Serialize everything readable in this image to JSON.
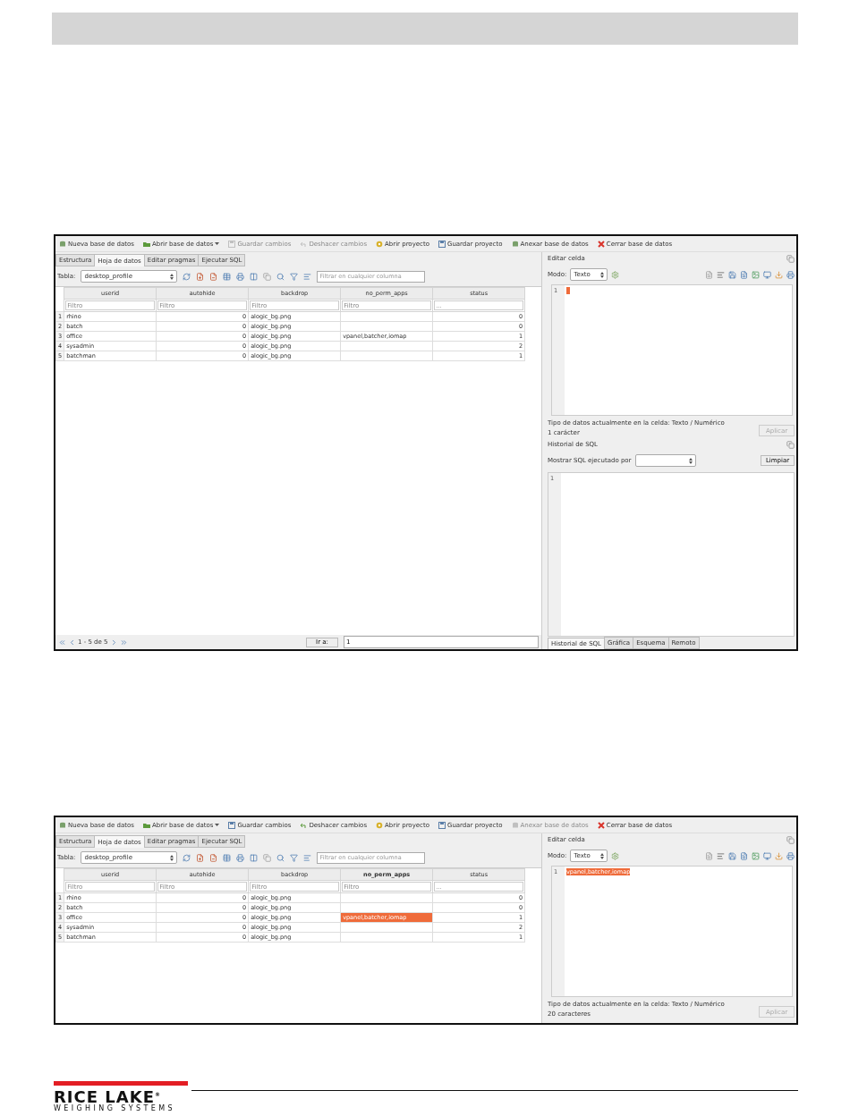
{
  "screenshots": [
    {
      "toolbar": [
        {
          "label": "Nueva base de datos",
          "kind": "database",
          "disabled": false
        },
        {
          "label": "Abrir base de datos",
          "kind": "open",
          "disabled": false,
          "menu": true
        },
        {
          "label": "Guardar cambios",
          "kind": "save",
          "disabled": true
        },
        {
          "label": "Deshacer cambios",
          "kind": "undo",
          "disabled": true
        },
        {
          "label": "Abrir proyecto",
          "kind": "project",
          "disabled": false
        },
        {
          "label": "Guardar proyecto",
          "kind": "save",
          "disabled": false
        },
        {
          "label": "Anexar base de datos",
          "kind": "database",
          "disabled": false
        },
        {
          "label": "Cerrar base de datos",
          "kind": "close",
          "disabled": false
        }
      ],
      "tabs": [
        {
          "label": "Estructura",
          "selected": false
        },
        {
          "label": "Hoja de datos",
          "selected": true
        },
        {
          "label": "Editar pragmas",
          "selected": false
        },
        {
          "label": "Ejecutar SQL",
          "selected": false
        }
      ],
      "table_label": "Tabla:",
      "table_value": "desktop_profile",
      "filter_placeholder": "Filtrar en cualquier columna",
      "columns": [
        {
          "label": "userid",
          "placeholder": "Filtro",
          "selected": false
        },
        {
          "label": "autohide",
          "placeholder": "Filtro",
          "selected": false
        },
        {
          "label": "backdrop",
          "placeholder": "Filtro",
          "selected": false
        },
        {
          "label": "no_perm_apps",
          "placeholder": "Filtro",
          "selected": false
        },
        {
          "label": "status",
          "placeholder": "...",
          "selected": false
        }
      ],
      "rows": [
        {
          "number": "1",
          "cells": [
            {
              "text": "rhino",
              "selected": false
            },
            {
              "text": "0",
              "selected": false
            },
            {
              "text": "alogic_bg.png",
              "selected": false
            },
            {
              "text": "",
              "selected": false
            },
            {
              "text": "0",
              "selected": false
            }
          ]
        },
        {
          "number": "2",
          "cells": [
            {
              "text": "batch",
              "selected": false
            },
            {
              "text": "0",
              "selected": false
            },
            {
              "text": "alogic_bg.png",
              "selected": false
            },
            {
              "text": "",
              "selected": false
            },
            {
              "text": "0",
              "selected": false
            }
          ]
        },
        {
          "number": "3",
          "cells": [
            {
              "text": "office",
              "selected": false
            },
            {
              "text": "0",
              "selected": false
            },
            {
              "text": "alogic_bg.png",
              "selected": false
            },
            {
              "text": "vpanel,batcher,iomap",
              "selected": false
            },
            {
              "text": "1",
              "selected": false
            }
          ]
        },
        {
          "number": "4",
          "cells": [
            {
              "text": "sysadmin",
              "selected": false
            },
            {
              "text": "0",
              "selected": false
            },
            {
              "text": "alogic_bg.png",
              "selected": false
            },
            {
              "text": "",
              "selected": false
            },
            {
              "text": "2",
              "selected": false
            }
          ]
        },
        {
          "number": "5",
          "cells": [
            {
              "text": "batchman",
              "selected": false
            },
            {
              "text": "0",
              "selected": false
            },
            {
              "text": "alogic_bg.png",
              "selected": false
            },
            {
              "text": "",
              "selected": false
            },
            {
              "text": "1",
              "selected": false
            }
          ]
        }
      ],
      "pager": {
        "range": "1 - 5 de 5",
        "goto_button": "Ir a:",
        "goto_value": "1"
      },
      "edit_cell": {
        "title": "Editar celda",
        "mode_label": "Modo:",
        "mode_value": "Texto",
        "line_number": "1",
        "type_info": "Tipo de datos actualmente en la celda: Texto / Numérico",
        "char_count": "1 carácter",
        "apply_button": "Aplicar",
        "apply_disabled": true
      },
      "sql_history": {
        "title": "Historial de SQL",
        "filter_label": "Mostrar SQL ejecutado por",
        "clear_button": "Limpiar",
        "line_number": "1"
      },
      "bottom_tabs": [
        {
          "label": "Historial de SQL",
          "selected": true
        },
        {
          "label": "Gráfica",
          "selected": false
        },
        {
          "label": "Esquema",
          "selected": false
        },
        {
          "label": "Remoto",
          "selected": false
        }
      ]
    },
    {
      "toolbar": [
        {
          "label": "Nueva base de datos",
          "kind": "database",
          "disabled": false
        },
        {
          "label": "Abrir base de datos",
          "kind": "open",
          "disabled": false,
          "menu": true
        },
        {
          "label": "Guardar cambios",
          "kind": "save",
          "disabled": false
        },
        {
          "label": "Deshacer cambios",
          "kind": "undo",
          "disabled": false
        },
        {
          "label": "Abrir proyecto",
          "kind": "project",
          "disabled": false
        },
        {
          "label": "Guardar proyecto",
          "kind": "save",
          "disabled": false
        },
        {
          "label": "Anexar base de datos",
          "kind": "database",
          "disabled": true
        },
        {
          "label": "Cerrar base de datos",
          "kind": "close",
          "disabled": false
        }
      ],
      "tabs": [
        {
          "label": "Estructura",
          "selected": false
        },
        {
          "label": "Hoja de datos",
          "selected": true
        },
        {
          "label": "Editar pragmas",
          "selected": false
        },
        {
          "label": "Ejecutar SQL",
          "selected": false
        }
      ],
      "table_label": "Tabla:",
      "table_value": "desktop_profile",
      "filter_placeholder": "Filtrar en cualquier columna",
      "columns": [
        {
          "label": "userid",
          "placeholder": "Filtro",
          "selected": false
        },
        {
          "label": "autohide",
          "placeholder": "Filtro",
          "selected": false
        },
        {
          "label": "backdrop",
          "placeholder": "Filtro",
          "selected": false
        },
        {
          "label": "no_perm_apps",
          "placeholder": "Filtro",
          "selected": true
        },
        {
          "label": "status",
          "placeholder": "...",
          "selected": false
        }
      ],
      "rows": [
        {
          "number": "1",
          "cells": [
            {
              "text": "rhino",
              "selected": false
            },
            {
              "text": "0",
              "selected": false
            },
            {
              "text": "alogic_bg.png",
              "selected": false
            },
            {
              "text": "",
              "selected": false
            },
            {
              "text": "0",
              "selected": false
            }
          ]
        },
        {
          "number": "2",
          "cells": [
            {
              "text": "batch",
              "selected": false
            },
            {
              "text": "0",
              "selected": false
            },
            {
              "text": "alogic_bg.png",
              "selected": false
            },
            {
              "text": "",
              "selected": false
            },
            {
              "text": "0",
              "selected": false
            }
          ]
        },
        {
          "number": "3",
          "cells": [
            {
              "text": "office",
              "selected": false
            },
            {
              "text": "0",
              "selected": false
            },
            {
              "text": "alogic_bg.png",
              "selected": false
            },
            {
              "text": "vpanel,batcher,iomap",
              "selected": true
            },
            {
              "text": "1",
              "selected": false
            }
          ]
        },
        {
          "number": "4",
          "cells": [
            {
              "text": "sysadmin",
              "selected": false
            },
            {
              "text": "0",
              "selected": false
            },
            {
              "text": "alogic_bg.png",
              "selected": false
            },
            {
              "text": "",
              "selected": false
            },
            {
              "text": "2",
              "selected": false
            }
          ]
        },
        {
          "number": "5",
          "cells": [
            {
              "text": "batchman",
              "selected": false
            },
            {
              "text": "0",
              "selected": false
            },
            {
              "text": "alogic_bg.png",
              "selected": false
            },
            {
              "text": "",
              "selected": false
            },
            {
              "text": "1",
              "selected": false
            }
          ]
        }
      ],
      "edit_cell": {
        "title": "Editar celda",
        "mode_label": "Modo:",
        "mode_value": "Texto",
        "line_number": "1",
        "content": "vpanel,batcher,iomap",
        "type_info": "Tipo de datos actualmente en la celda: Texto / Numérico",
        "char_count": "20 caracteres",
        "apply_button": "Aplicar",
        "apply_disabled": true
      }
    }
  ],
  "footer": {
    "brand": "RICE LAKE",
    "mark": "®",
    "tagline": "WEIGHING SYSTEMS"
  }
}
